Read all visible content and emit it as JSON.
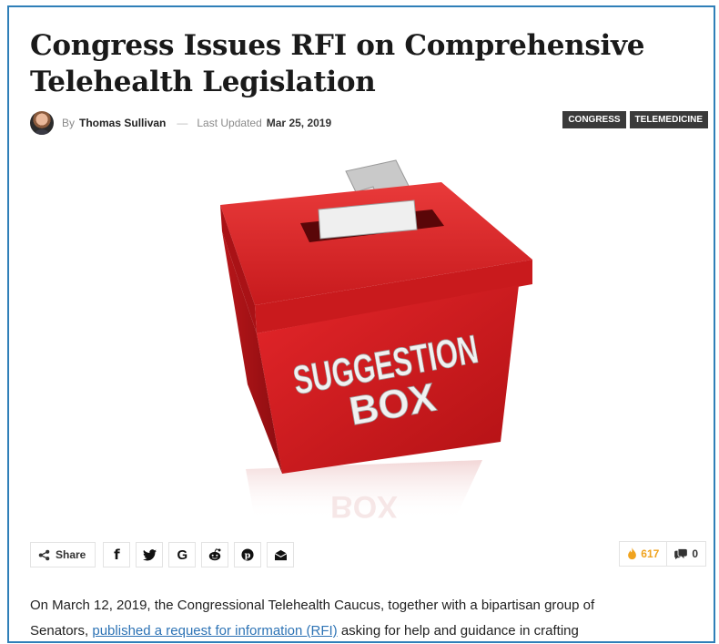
{
  "article": {
    "title": "Congress Issues RFI on Comprehensive Telehealth Legislation",
    "byline": {
      "by": "By",
      "author": "Thomas Sullivan",
      "separator": "—",
      "updated_label": "Last Updated",
      "updated_date": "Mar 25, 2019"
    },
    "tags": [
      "CONGRESS",
      "TELEMEDICINE"
    ],
    "hero": {
      "box_line1": "SUGGESTION",
      "box_line2": "BOX",
      "reflection": "BOX"
    },
    "share": {
      "label": "Share",
      "networks": [
        {
          "icon": "facebook-icon",
          "glyph": "f"
        },
        {
          "icon": "twitter-icon",
          "glyph": "🐦"
        },
        {
          "icon": "google-icon",
          "glyph": "G"
        },
        {
          "icon": "reddit-icon",
          "glyph": "👽"
        },
        {
          "icon": "pinterest-icon",
          "glyph": "℗"
        },
        {
          "icon": "email-icon",
          "glyph": "✉"
        }
      ]
    },
    "counters": {
      "views": "617",
      "comments": "0"
    },
    "body": {
      "line1": "On March 12, 2019, the Congressional Telehealth Caucus, together with a bipartisan group of",
      "line2_start": "Senators, ",
      "line2_link": "published a request for information (RFI)",
      "line2_end": " asking for help and guidance in crafting"
    }
  },
  "colors": {
    "frame": "#2f7fb8",
    "tag_bg": "#3a3a3a",
    "box_red": "#d8191c",
    "link": "#2d73b5",
    "views": "#f0a31e"
  }
}
